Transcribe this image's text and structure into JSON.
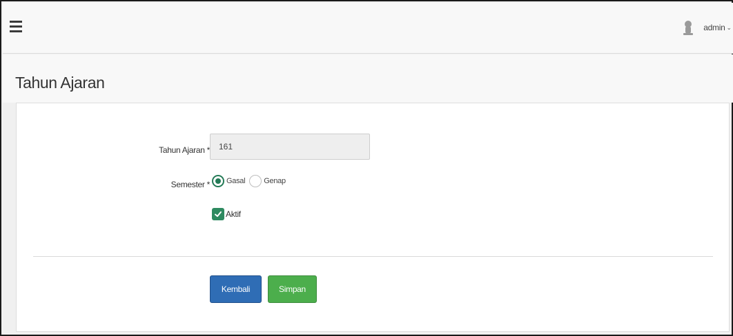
{
  "navbar": {
    "menu_icon": "hamburger-menu-icon",
    "user": {
      "icon": "user-silhouette-icon",
      "name": "admin",
      "caret": "⌄"
    }
  },
  "page": {
    "title": "Tahun Ajaran"
  },
  "form": {
    "tahun_ajaran": {
      "label": "Tahun Ajaran *",
      "value": "161"
    },
    "semester": {
      "label": "Semester *",
      "options": [
        {
          "label": "Gasal",
          "selected": true
        },
        {
          "label": "Genap",
          "selected": false
        }
      ]
    },
    "aktif": {
      "label": "Aktif",
      "checked": true
    }
  },
  "actions": {
    "back_label": "Kembali",
    "save_label": "Simpan"
  },
  "colors": {
    "primary": "#2f6db5",
    "success": "#4cae4c",
    "accent_green": "#237a56"
  }
}
